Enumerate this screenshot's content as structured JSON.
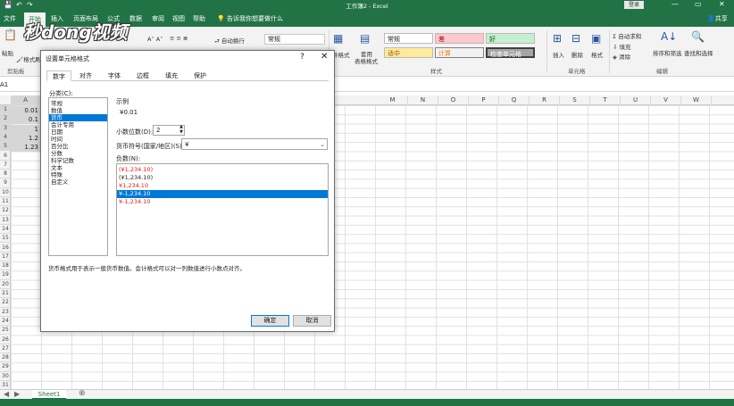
{
  "window": {
    "title": "工作簿2 - Excel",
    "login_label": "登录",
    "share_label": "共享",
    "minimize": "—",
    "restore": "▭",
    "close": "✕"
  },
  "ribbon_tabs": [
    "文件",
    "开始",
    "插入",
    "页面布局",
    "公式",
    "数据",
    "审阅",
    "视图",
    "帮助"
  ],
  "tell_me": "告诉我你想要做什么",
  "ribbon": {
    "paste": "粘贴",
    "clipboard_group": "剪贴板",
    "format_painter": "格式刷",
    "wrap_text": "自动换行",
    "number_format": "常规",
    "conditional_format": "件格式",
    "table_format_1": "套用",
    "table_format_2": "表格格式",
    "styles": {
      "normal": "常规",
      "bad": "差",
      "good": "好",
      "neutral": "适中",
      "calculation": "计算",
      "check_cell": "检查单元格"
    },
    "styles_group": "样式",
    "insert": "插入",
    "delete": "删除",
    "format": "格式",
    "cells_group": "单元格",
    "autosum": "自动求和",
    "fill": "填充",
    "clear": "清除",
    "sort_filter": "排序和筛选",
    "find_select": "查找和选择",
    "editing_group": "编辑"
  },
  "watermark": "秒dong视频",
  "name_box": "A1",
  "columns": [
    "A",
    "M",
    "N",
    "O",
    "P",
    "Q",
    "R",
    "S",
    "T",
    "U",
    "V",
    "W"
  ],
  "rows": [
    "1",
    "2",
    "3",
    "4",
    "5",
    "6",
    "7",
    "8",
    "9",
    "10",
    "11",
    "12",
    "13",
    "14",
    "15",
    "16",
    "17",
    "18",
    "19",
    "20",
    "21",
    "22",
    "23",
    "24",
    "25",
    "26",
    "27",
    "28",
    "29",
    "30",
    "31"
  ],
  "cells": [
    "0.01",
    "0.1",
    "1",
    "1.2",
    "1.23"
  ],
  "sheet_tab": "Sheet1",
  "dialog": {
    "title": "设置单元格格式",
    "help": "?",
    "close": "✕",
    "tabs": [
      "数字",
      "对齐",
      "字体",
      "边框",
      "填充",
      "保护"
    ],
    "category_label": "分类(C):",
    "categories": [
      "常规",
      "数值",
      "货币",
      "会计专用",
      "日期",
      "时间",
      "百分比",
      "分数",
      "科学记数",
      "文本",
      "特殊",
      "自定义"
    ],
    "selected_category": "货币",
    "sample_label": "示例",
    "sample_value": "¥0.01",
    "decimal_label": "小数位数(D):",
    "decimal_value": "2",
    "symbol_label": "货币符号(国家/地区)(S):",
    "symbol_value": "¥",
    "negative_label": "负数(N):",
    "negatives": [
      {
        "text": "(¥1,234.10)",
        "red": true,
        "selected": false
      },
      {
        "text": "(¥1,234.10)",
        "red": false,
        "selected": false
      },
      {
        "text": "¥1,234.10",
        "red": true,
        "selected": false
      },
      {
        "text": "¥-1,234.10",
        "red": false,
        "selected": true
      },
      {
        "text": "¥-1,234.10",
        "red": true,
        "selected": false
      }
    ],
    "description": "货币格式用于表示一般货币数值。会计格式可以对一列数值进行小数点对齐。",
    "ok": "确定",
    "cancel": "取消"
  }
}
